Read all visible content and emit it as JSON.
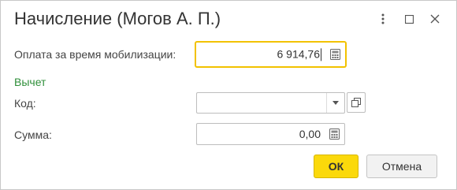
{
  "window": {
    "title": "Начисление (Могов А. П.)",
    "icons": [
      "more-icon",
      "maximize-icon",
      "close-icon"
    ]
  },
  "form": {
    "mobilization_pay": {
      "label": "Оплата за время мобилизации:",
      "value": "6 914,76"
    },
    "deduction_section": {
      "label": "Вычет"
    },
    "code": {
      "label": "Код:",
      "value": ""
    },
    "amount": {
      "label": "Сумма:",
      "value": "0,00"
    }
  },
  "buttons": {
    "ok_label": "ОК",
    "cancel_label": "Отмена"
  },
  "colors": {
    "accent_yellow": "#fbd90b",
    "focus_border": "#f2c200",
    "section_green": "#2f8f3a"
  }
}
